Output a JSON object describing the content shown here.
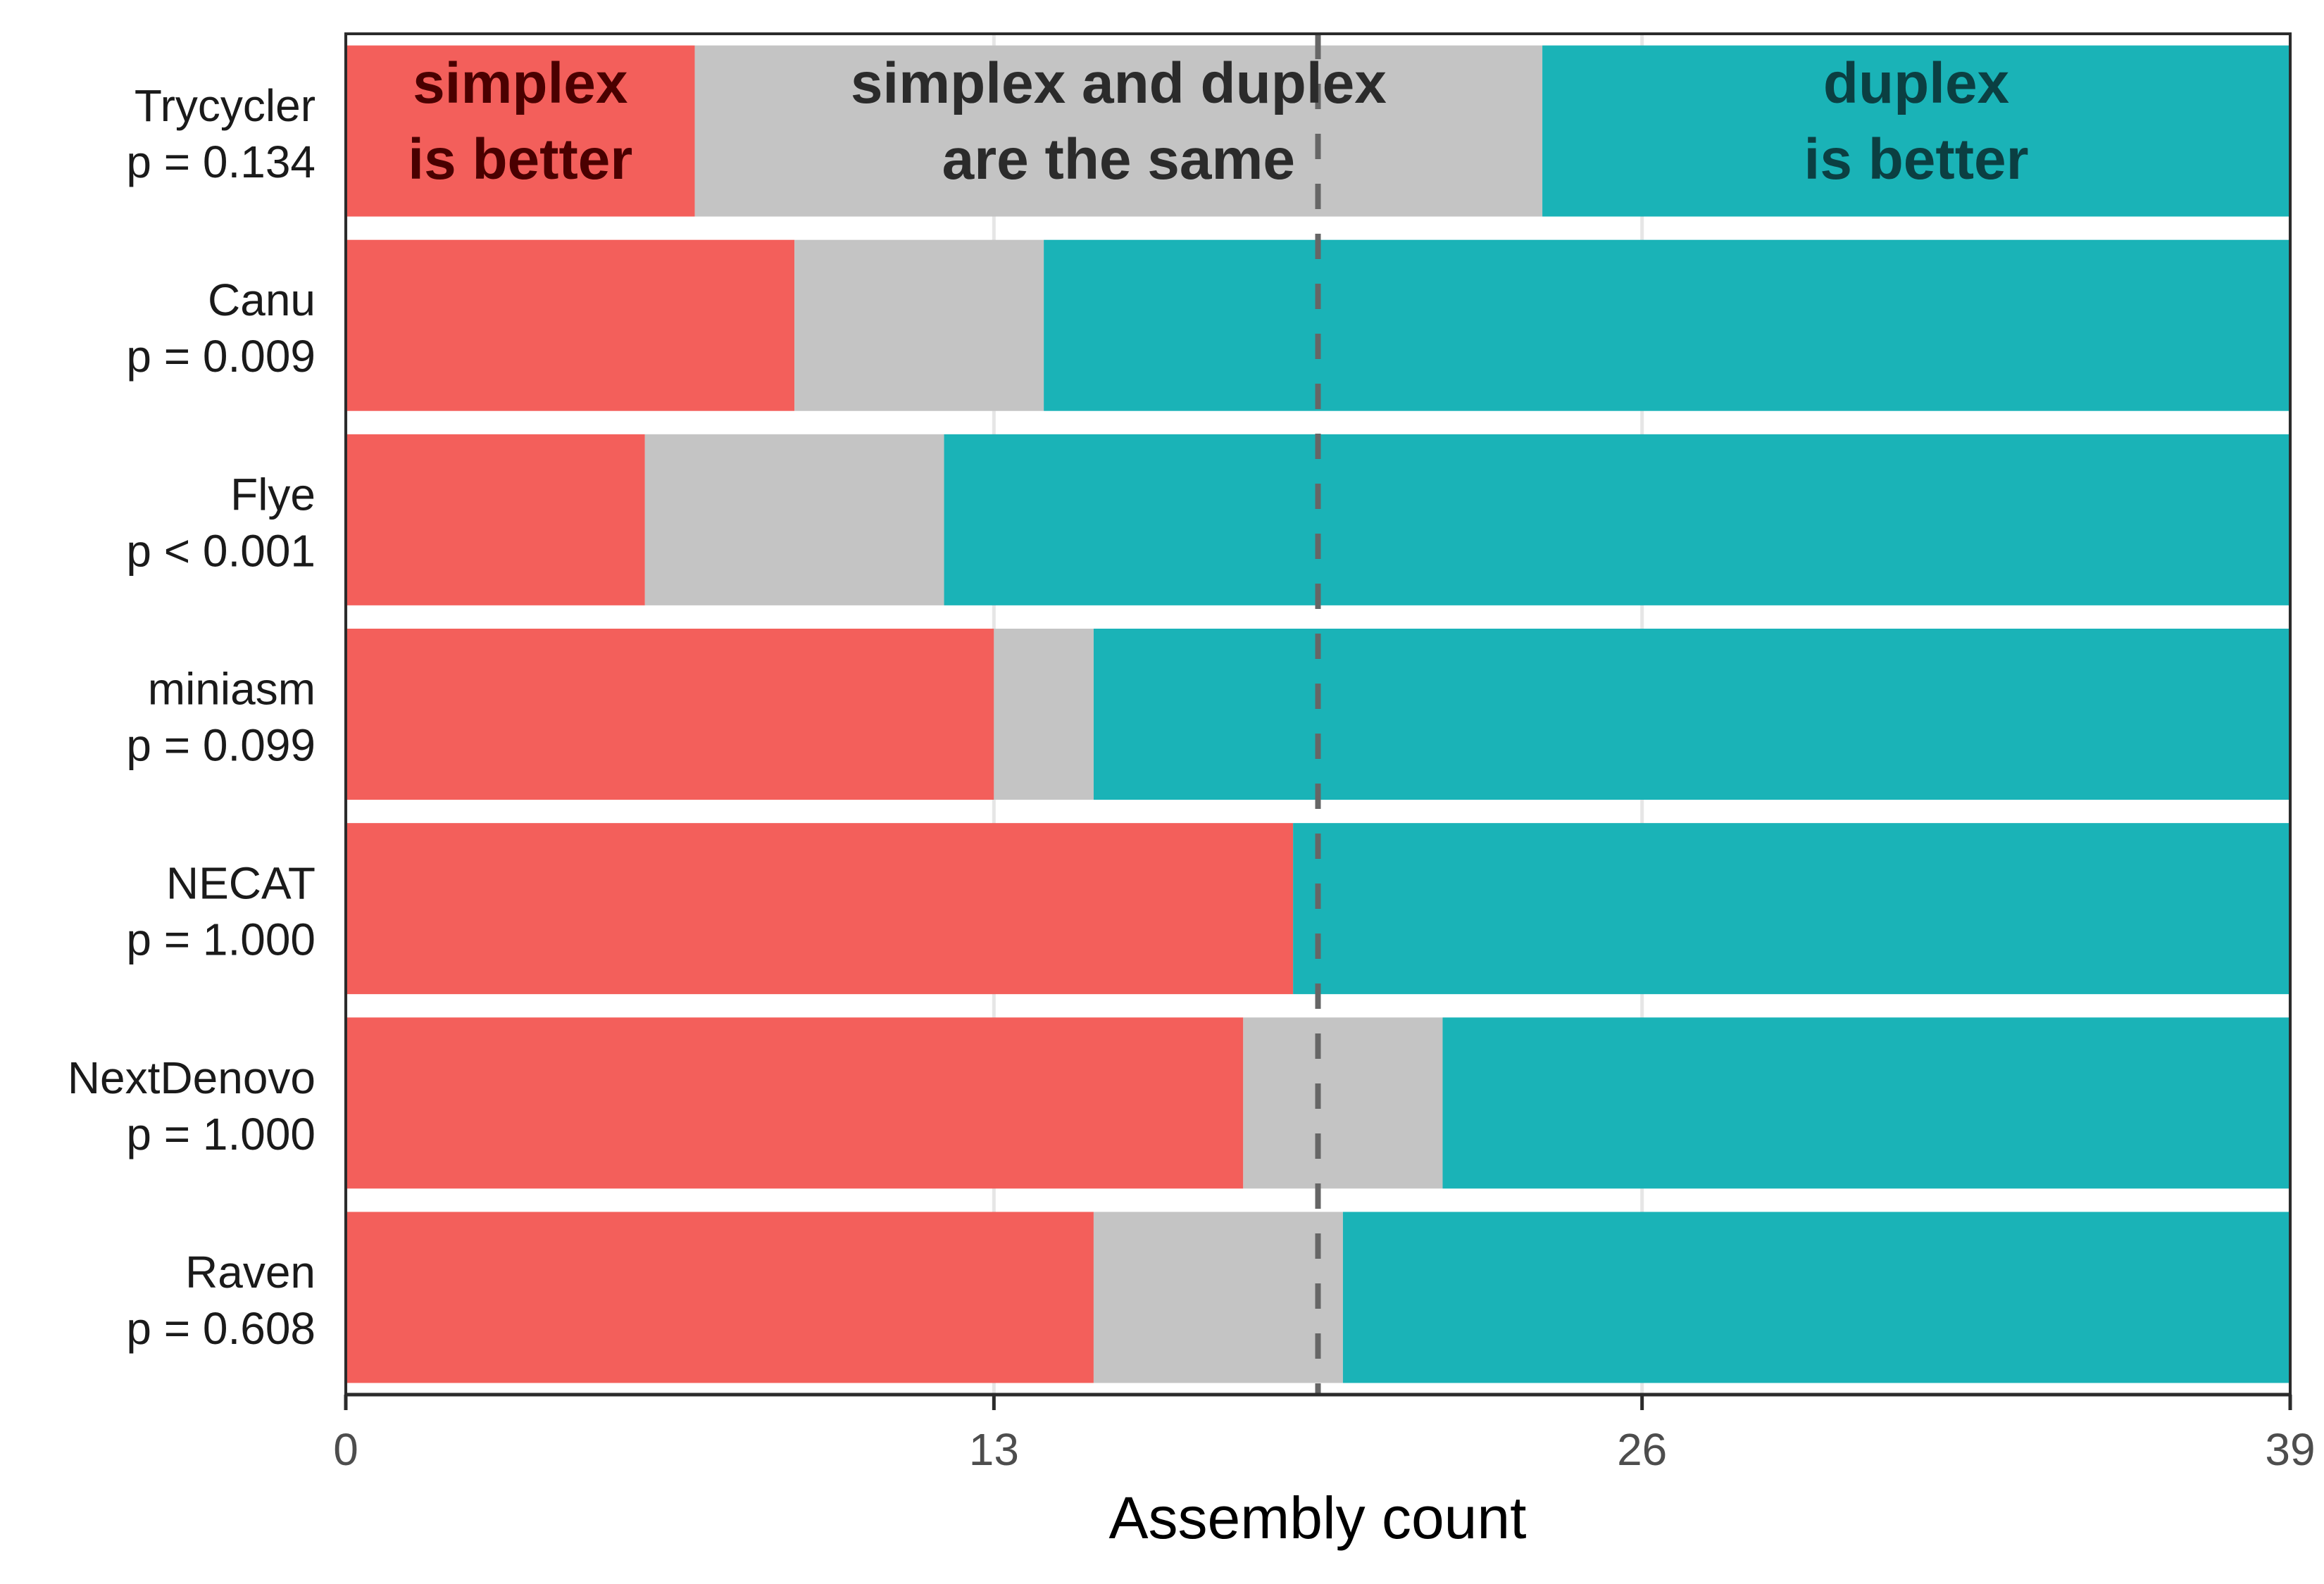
{
  "chart_data": {
    "type": "bar",
    "orientation": "horizontal",
    "stacked": true,
    "title": "",
    "xlabel": "Assembly count",
    "ylabel": "",
    "xlim": [
      0,
      39
    ],
    "xticks": [
      "0",
      "13",
      "26",
      "39"
    ],
    "xtick_values": [
      0,
      13,
      26,
      39
    ],
    "grid": "vertical major gridlines",
    "reference_line": {
      "x": 19.5,
      "style": "dashed",
      "color": "#666666"
    },
    "categories": [
      "Trycycler",
      "Canu",
      "Flye",
      "miniasm",
      "NECAT",
      "NextDenovo",
      "Raven"
    ],
    "category_labels": [
      [
        "Trycycler",
        "p = 0.134"
      ],
      [
        "Canu",
        "p = 0.009"
      ],
      [
        "Flye",
        "p < 0.001"
      ],
      [
        "miniasm",
        "p = 0.099"
      ],
      [
        "NECAT",
        "p = 1.000"
      ],
      [
        "NextDenovo",
        "p = 1.000"
      ],
      [
        "Raven",
        "p = 0.608"
      ]
    ],
    "series": [
      {
        "name": "simplex is better",
        "color": "#F35F5B",
        "values": [
          7,
          9,
          6,
          13,
          19,
          18,
          15
        ]
      },
      {
        "name": "simplex and duplex are the same",
        "color": "#C4C4C4",
        "values": [
          17,
          5,
          6,
          2,
          0,
          4,
          5
        ]
      },
      {
        "name": "duplex is better",
        "color": "#1AB3B7",
        "values": [
          15,
          25,
          27,
          24,
          20,
          17,
          19
        ]
      }
    ],
    "annotations": [
      {
        "series": 0,
        "lines": [
          "simplex",
          "is better"
        ],
        "color": "#4a0000"
      },
      {
        "series": 1,
        "lines": [
          "simplex and duplex",
          "are the same"
        ],
        "color": "#2b2b2b"
      },
      {
        "series": 2,
        "lines": [
          "duplex",
          "is better"
        ],
        "color": "#0b3f42"
      }
    ],
    "legend": "none (annotated inside first bar)"
  }
}
